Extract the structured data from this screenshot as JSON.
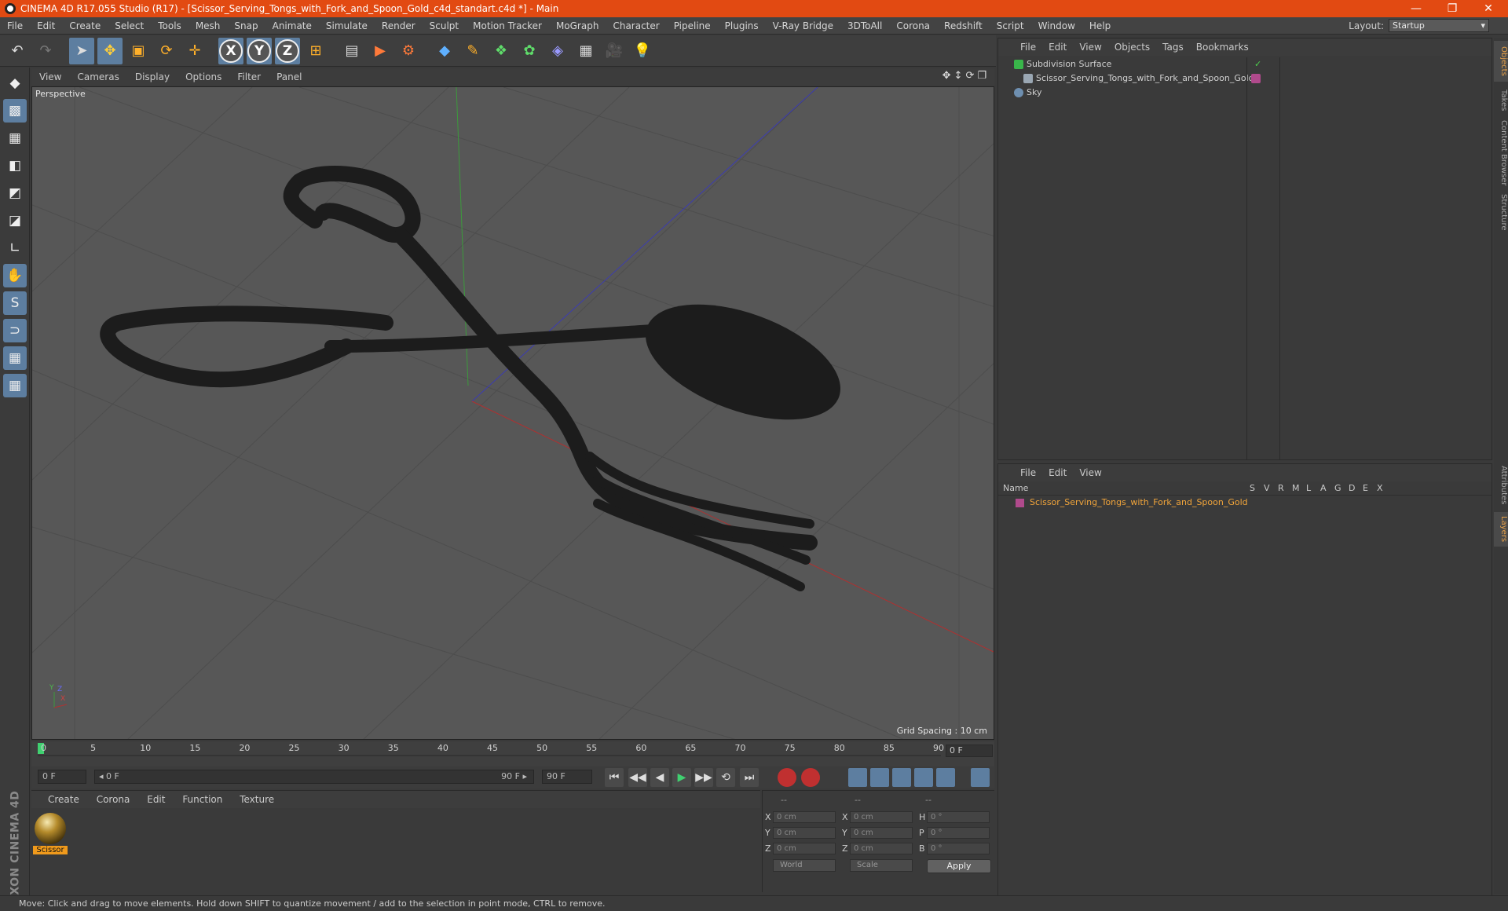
{
  "window": {
    "title": "CINEMA 4D R17.055 Studio (R17) - [Scissor_Serving_Tongs_with_Fork_and_Spoon_Gold_c4d_standart.c4d *] - Main",
    "minimize": "—",
    "restore": "❐",
    "close": "✕"
  },
  "menubar": [
    "File",
    "Edit",
    "Create",
    "Select",
    "Tools",
    "Mesh",
    "Snap",
    "Animate",
    "Simulate",
    "Render",
    "Sculpt",
    "Motion Tracker",
    "MoGraph",
    "Character",
    "Pipeline",
    "Plugins",
    "V-Ray Bridge",
    "3DToAll",
    "Corona",
    "Redshift",
    "Script",
    "Window",
    "Help"
  ],
  "layout": {
    "label": "Layout:",
    "value": "Startup"
  },
  "toolbar": {
    "undo": "↶",
    "redo": "↷",
    "select": "➤",
    "move": "✥",
    "scale": "▣",
    "rotate": "⟳",
    "transform": "✛",
    "axis_x": "X",
    "axis_y": "Y",
    "axis_z": "Z",
    "coord": "⊞",
    "render_view": "▤",
    "render": "▶",
    "render_settings": "⚙",
    "cube": "◆",
    "pen": "✎",
    "subdiv": "❖",
    "array": "✿",
    "deformer": "◈",
    "floor": "▦",
    "camera": "🎥",
    "light": "💡"
  },
  "left_tools": [
    "◆",
    "▩",
    "▦",
    "◧",
    "◩",
    "◪",
    "∟",
    "✋",
    "S",
    "⊃",
    "▦",
    "▦"
  ],
  "maxon_logo": "MAXON CINEMA 4D",
  "viewport": {
    "menu": [
      "View",
      "Cameras",
      "Display",
      "Options",
      "Filter",
      "Panel"
    ],
    "nav": "✥↕⟳❐",
    "label": "Perspective",
    "grid_spacing": "Grid Spacing : 10 cm",
    "axis_y": "Y",
    "axis_z": "Z",
    "axis_x": "X"
  },
  "timeline": {
    "ticks": [
      "0",
      "5",
      "10",
      "15",
      "20",
      "25",
      "30",
      "35",
      "40",
      "45",
      "50",
      "55",
      "60",
      "65",
      "70",
      "75",
      "80",
      "85",
      "90"
    ],
    "frame_end": "0 F"
  },
  "transport": {
    "start": "0 F",
    "range_start": "◂ 0 F",
    "range_end": "90 F ▸",
    "end": "90 F",
    "buttons": [
      "⏮",
      "◀◀",
      "◀",
      "▶",
      "▶▶",
      "⟲",
      "⏭"
    ]
  },
  "materials": {
    "menu": [
      "Create",
      "Corona",
      "Edit",
      "Function",
      "Texture"
    ],
    "items": [
      {
        "name": "Scissor"
      }
    ]
  },
  "coords": {
    "headers": [
      "--",
      "--",
      "--"
    ],
    "rows": [
      {
        "a": "X",
        "av": "0 cm",
        "b": "X",
        "bv": "0 cm",
        "c": "H",
        "cv": "0 °"
      },
      {
        "a": "Y",
        "av": "0 cm",
        "b": "Y",
        "bv": "0 cm",
        "c": "P",
        "cv": "0 °"
      },
      {
        "a": "Z",
        "av": "0 cm",
        "b": "Z",
        "bv": "0 cm",
        "c": "B",
        "cv": "0 °"
      }
    ],
    "space": "World",
    "mode": "Scale",
    "apply": "Apply"
  },
  "objects_panel": {
    "menu": [
      "File",
      "Edit",
      "View",
      "Objects",
      "Tags",
      "Bookmarks"
    ],
    "items": [
      {
        "name": "Subdivision Surface",
        "color": "#39b54a"
      },
      {
        "name": "Scissor_Serving_Tongs_with_Fork_and_Spoon_Gold",
        "color": "#9aa7b3"
      },
      {
        "name": "Sky",
        "color": "#6e8fb0"
      }
    ]
  },
  "layers_panel": {
    "menu": [
      "File",
      "Edit",
      "View"
    ],
    "name_header": "Name",
    "cols": [
      "S",
      "V",
      "R",
      "M",
      "L",
      "A",
      "G",
      "D",
      "E",
      "X"
    ],
    "items": [
      {
        "name": "Scissor_Serving_Tongs_with_Fork_and_Spoon_Gold",
        "color": "#b04a8c"
      }
    ]
  },
  "right_tabs": [
    "Objects",
    "Takes",
    "Content Browser",
    "Structure",
    "Attributes",
    "Layers"
  ],
  "status": "Move: Click and drag to move elements. Hold down SHIFT to quantize movement / add to the selection in point mode, CTRL to remove."
}
